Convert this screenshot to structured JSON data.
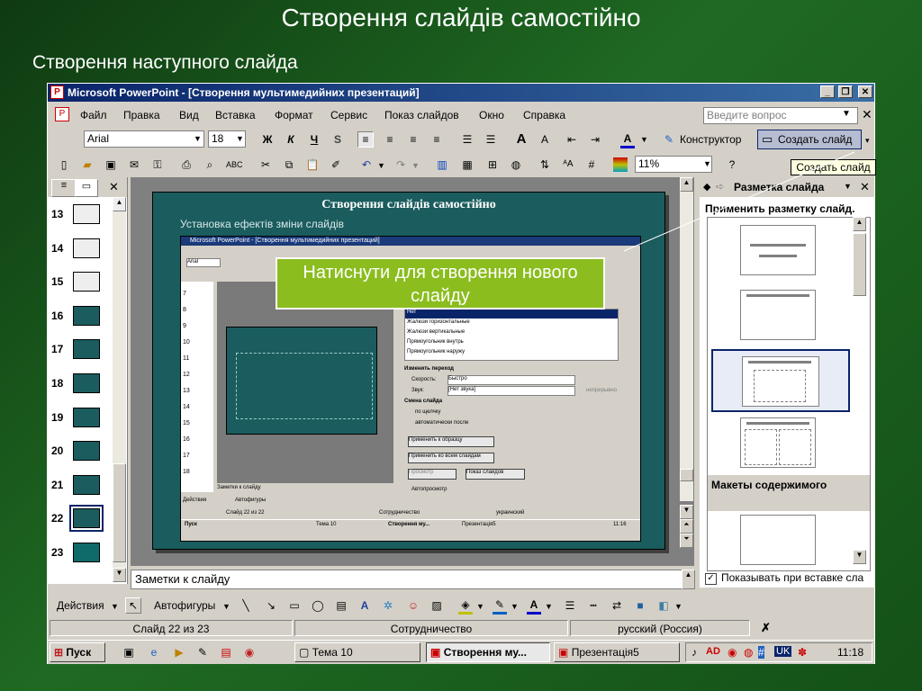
{
  "slide": {
    "title": "Створення слайдів самостійно",
    "subtitle": "Створення наступного слайда"
  },
  "window": {
    "title": "Microsoft PowerPoint - [Створення мультимедийних презентаций]",
    "min_icon": "_",
    "restore_icon": "❐",
    "close_icon": "✕"
  },
  "menu": {
    "items": [
      "Файл",
      "Правка",
      "Вид",
      "Вставка",
      "Формат",
      "Сервис",
      "Показ слайдов",
      "Окно",
      "Справка"
    ],
    "help_placeholder": "Введите вопрос"
  },
  "format_bar": {
    "font": "Arial",
    "size": "18",
    "bold": "Ж",
    "italic": "К",
    "underline": "Ч",
    "shadow": "S",
    "grow": "A",
    "designer": "Конструктор",
    "new_slide": "Создать слайд"
  },
  "standard_bar": {
    "zoom": "11%"
  },
  "tooltip": "Создать слайд",
  "outline_tabs": {
    "close": "✕"
  },
  "thumbs": [
    "13",
    "14",
    "15",
    "16",
    "17",
    "18",
    "19",
    "20",
    "21",
    "22",
    "23"
  ],
  "editor": {
    "inner_title": "Створення слайдів самостійно",
    "inner_subtitle": "Установка ефектів зміни слайдів",
    "inner_window_title": "Microsoft PowerPoint - [Створення мультимедийних презентаций]",
    "callout": "Натиснути для створення нового слайду",
    "notes_placeholder": "Заметки к слайду",
    "inner_list": [
      "Нет",
      "Жалюзи горизонтальные",
      "Жалюзи вертикальные",
      "Прямоугольник внутрь",
      "Прямоугольник наружу"
    ],
    "inner_change": "Изменить переход",
    "inner_speed_label": "Скорость:",
    "inner_speed": "Быстро",
    "inner_sound_label": "Звук:",
    "inner_sound": "[Нет звука]",
    "inner_loop": "непрерывно",
    "inner_advance": "Смена слайда",
    "inner_on_click": "по щелчку",
    "inner_auto": "автоматически после",
    "inner_apply_master": "Применить к образцу",
    "inner_apply_all": "Применить ко всем слайдам",
    "inner_preview": "Просмотр",
    "inner_show": "Показ слайдов",
    "inner_autopreview": "Автопросмотр",
    "inner_notes": "Заметки к слайду",
    "inner_slide_of": "Слайд 22 из 22",
    "inner_design": "Сотрудничество",
    "inner_lang": "украинский",
    "inner_task_start": "Пуск",
    "inner_task_1": "Тема 10",
    "inner_task_2": "Створення му...",
    "inner_task_3": "Презентація5",
    "inner_clock": "11:16",
    "inner_actions": "Действия",
    "inner_autoshapes": "Автофигуры"
  },
  "task_pane": {
    "title": "Разметка слайда",
    "apply_label": "Применить разметку слайд.",
    "section": "Макеты содержимого",
    "show_on_insert": "Показывать при вставке сла"
  },
  "drawing_bar": {
    "actions": "Действия",
    "autoshapes": "Автофигуры"
  },
  "status": {
    "slide_of": "Слайд 22 из 23",
    "design": "Сотрудничество",
    "language": "русский (Россия)"
  },
  "taskbar": {
    "start": "Пуск",
    "items": [
      "Тема 10",
      "Створення му...",
      "Презентація5"
    ],
    "lang": "UK",
    "clock": "11:18"
  },
  "colors": {
    "accent_green": "#8bbd1f",
    "slide_teal": "#1b5c5e",
    "titlebar": "#0a246a"
  }
}
